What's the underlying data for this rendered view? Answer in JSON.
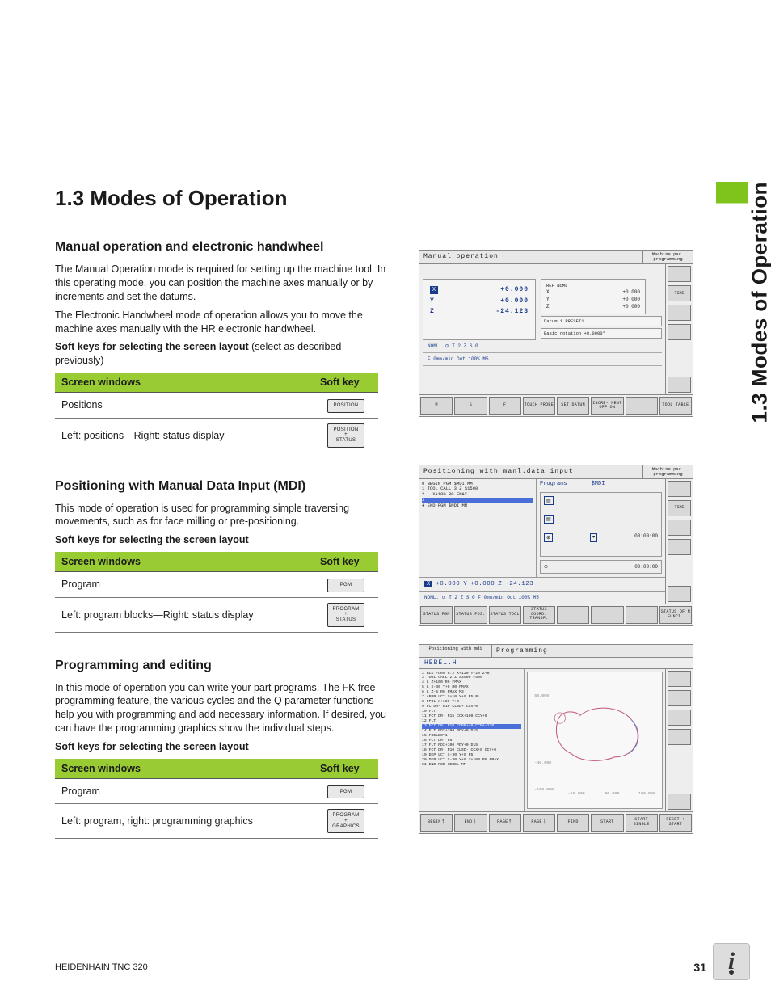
{
  "sideTab": "1.3 Modes of Operation",
  "h1": "1.3  Modes of Operation",
  "sec1": {
    "h2": "Manual operation and electronic handwheel",
    "p1": "The Manual Operation mode is required for setting up the machine tool. In this operating mode, you can position the machine axes manually or by increments and set the datums.",
    "p2": "The Electronic Handwheel mode of operation allows you to move the machine axes manually with the HR electronic handwheel.",
    "cap_b": "Soft keys for selecting the screen layout",
    "cap_r": " (select as described previously)",
    "th1": "Screen windows",
    "th2": "Soft key",
    "r1c1": "Positions",
    "r1c2": "POSITION",
    "r2c1": "Left: positions—Right: status display",
    "r2c2": "POSITION\n+\nSTATUS"
  },
  "sec2": {
    "h2": "Positioning with Manual Data Input (MDI)",
    "p1": "This mode of operation is used for programming simple traversing movements, such as for face milling or pre-positioning.",
    "cap": "Soft keys for selecting the screen layout",
    "th1": "Screen windows",
    "th2": "Soft key",
    "r1c1": "Program",
    "r1c2": "PGM",
    "r2c1": "Left: program blocks—Right: status display",
    "r2c2": "PROGRAM\n+\nSTATUS"
  },
  "sec3": {
    "h2": "Programming and editing",
    "p1": "In this mode of operation you can write your part programs. The FK free programming feature, the various cycles and the Q parameter functions help you with programming and add necessary information. If desired, you can have the programming graphics show the individual steps.",
    "cap": "Soft keys for selecting the screen layout",
    "th1": "Screen windows",
    "th2": "Soft key",
    "r1c1": "Program",
    "r1c2": "PGM",
    "r2c1": "Left: program, right: programming graphics",
    "r2c2": "PROGRAM\n+\nGRAPHICS"
  },
  "ss1": {
    "title": "Manual operation",
    "titleSide": "Machine par. programming",
    "axes": {
      "X": "+0.000",
      "Y": "+0.000",
      "Z": "-24.123"
    },
    "refHead": "REF NOML",
    "ref": {
      "X": "+0.000",
      "Y": "+0.000",
      "Z": "+0.000"
    },
    "datum": "Datum    1        PRESET1",
    "basic": "Basic rotation      +0.0000°",
    "status1": "NOML.  ⊙    T    2 Z S    0",
    "status2": "F   0mm/min   Out  100%   M5",
    "railTime": "TIME",
    "bottom": [
      "M",
      "S",
      "F",
      "TOUCH PROBE",
      "SET DATUM",
      "INCRE- MENT OFF ON",
      "",
      "TOOL TABLE"
    ]
  },
  "ss2": {
    "title": "Positioning with manl.data input",
    "titleSide": "Machine par. programming",
    "prgHead1": "Programs",
    "prgHead2": "$MDI",
    "lines": [
      "0  BEGIN PGM $MDI MM",
      "1  TOOL CALL 3 Z S1500",
      "2  L  X+100 R0 FMAX",
      "3  ",
      "4  END PGM $MDI MM"
    ],
    "time1": "00:00:00",
    "time2": "00:00:00",
    "coords": {
      "X": "+0.000",
      "Y": "+0.000",
      "Z": "-24.123"
    },
    "status": "NOML.  ⊙     T   2  Z  S    0  F   0mm/min   Out  100%   M5",
    "railTime": "TIME",
    "bottom": [
      "STATUS PGM",
      "STATUS POS.",
      "STATUS TOOL",
      "STATUS COORD. TRANSF.",
      "",
      "",
      "",
      "STATUS OF M FUNCT."
    ]
  },
  "ss3": {
    "titleSide": "Positioning with mdi",
    "title": "Programming",
    "file": "HEBEL.H",
    "lines": [
      "2  BLK FORM 0.2  X+120  Y+20  Z+0",
      "3  TOOL CALL 2 Z S3500 F500",
      "4  L  Z+100 R0 FMAX",
      "5  L  X-30 Y+0 R0 FMAX",
      "6  L  Z-5 R0 FMAX M3",
      "7  APPR LCT  X+10  Y+0 R5 RL",
      "8  FPOL  X+100  Y+0",
      "9  FC DR- R10 CLSD+  CCX+0",
      "10 FLT",
      "11 FCT DR- R15  CCX+100  CCY+0",
      "12 FLT",
      "13 FCT DR- R10  CCPR+40  CCPA-110",
      "14 FLT PDX+100 PDY+0 D15",
      "15 FSELECT1",
      "16 FCT DR- R5",
      "17 FLT PDX+100 PDY+0 D15",
      "18 FCT DR- R10 CLSD-  CCX+0  CCY+0",
      "19 DEP LCT  X-30  Y+0 R5",
      "20 DEP LCT  X-30  Y+0  Z+100 R5 FMAX",
      "21 END PGM HEBEL MM"
    ],
    "bottom": [
      "BEGIN",
      "END",
      "PAGE",
      "PAGE",
      "FIND",
      "START",
      "START SINGLE",
      "RESET + START"
    ]
  },
  "footer": {
    "left": "HEIDENHAIN TNC 320",
    "page": "31"
  }
}
